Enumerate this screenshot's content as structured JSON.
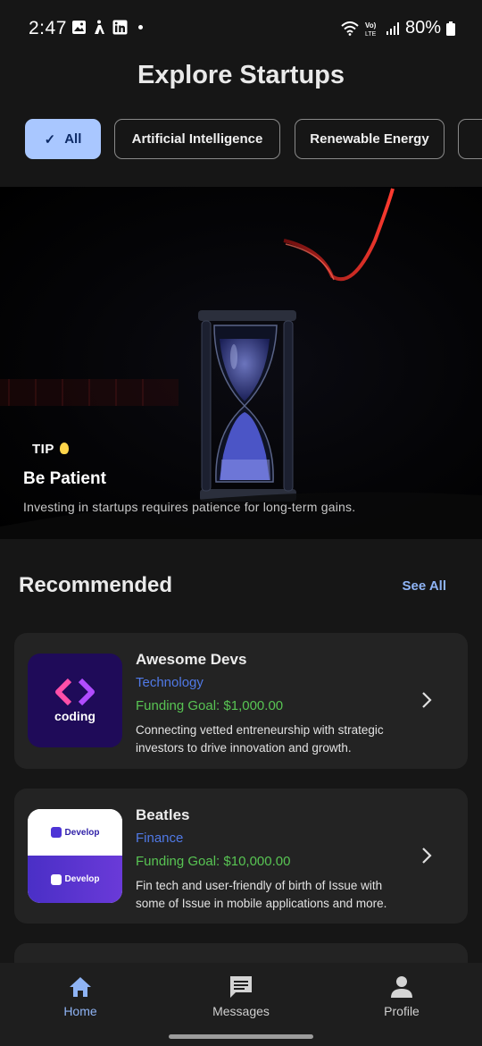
{
  "status_bar": {
    "time": "2:47",
    "battery": "80%",
    "icons": [
      "gallery-icon",
      "accessibility-icon",
      "linkedin-icon",
      "dot-icon",
      "wifi-icon",
      "volte-icon",
      "signal-icon",
      "battery-icon"
    ]
  },
  "header": {
    "title": "Explore Startups"
  },
  "filters": {
    "chips": [
      {
        "label": "All",
        "selected": true
      },
      {
        "label": "Artificial Intelligence",
        "selected": false
      },
      {
        "label": "Renewable Energy",
        "selected": false
      }
    ]
  },
  "tip": {
    "label": "TIP",
    "title": "Be Patient",
    "description": "Investing in startups requires patience for long-term gains."
  },
  "recommended": {
    "title": "Recommended",
    "see_all": "See All",
    "items": [
      {
        "name": "Awesome Devs",
        "category": "Technology",
        "funding_goal": "Funding Goal: $1,000.00",
        "description": "Connecting vetted entreneurship with strategic investors to drive innovation and growth.",
        "logo_text": "coding"
      },
      {
        "name": "Beatles",
        "category": "Finance",
        "funding_goal": "Funding Goal: $10,000.00",
        "description": "Fin tech and user-friendly of birth of Issue with some of Issue in mobile applications and more.",
        "logo_text": "Develop"
      }
    ]
  },
  "colors": {
    "background": "#161616",
    "accent": "#a9c7ff",
    "link": "#8fb4f5",
    "category": "#5079e6",
    "funding": "#58c453",
    "card": "#232323"
  },
  "bottom_nav": {
    "items": [
      {
        "label": "Home",
        "icon": "home-icon",
        "active": true
      },
      {
        "label": "Messages",
        "icon": "message-icon",
        "active": false
      },
      {
        "label": "Profile",
        "icon": "person-icon",
        "active": false
      }
    ]
  }
}
